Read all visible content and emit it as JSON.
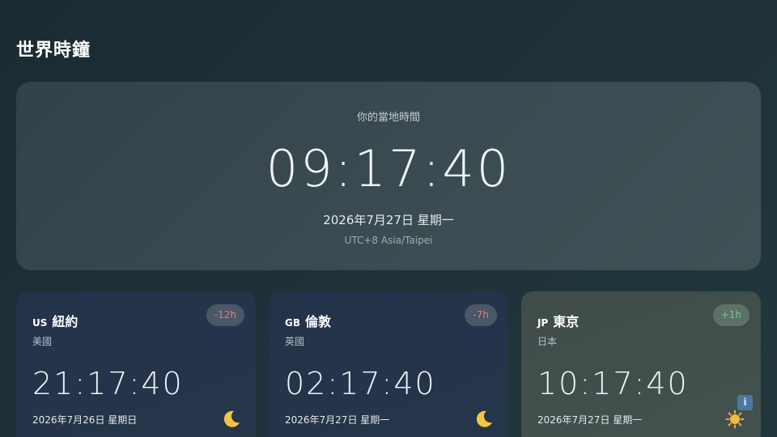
{
  "app": {
    "title": "世界時鐘"
  },
  "local": {
    "label": "你的當地時間",
    "time": "09:17:40",
    "date": "2026年7月27日 星期一",
    "timezone": "UTC+8 Asia/Taipei"
  },
  "cities": [
    {
      "code": "US",
      "name": "紐約",
      "country": "美國",
      "offset": "-12h",
      "time": "21:17:40",
      "date": "2026年7月26日 星期日",
      "period_icon": "moon-icon"
    },
    {
      "code": "GB",
      "name": "倫敦",
      "country": "英國",
      "offset": "-7h",
      "time": "02:17:40",
      "date": "2026年7月27日 星期一",
      "period_icon": "moon-icon"
    },
    {
      "code": "JP",
      "name": "東京",
      "country": "日本",
      "offset": "+1h",
      "time": "10:17:40",
      "date": "2026年7月27日 星期一",
      "period_icon": "sun-icon",
      "info_label": "i"
    }
  ],
  "colors": {
    "negative_offset": "#f07a7a",
    "positive_offset": "#67d48e",
    "night_card": "#24344a",
    "day_card": "#414f4d"
  }
}
